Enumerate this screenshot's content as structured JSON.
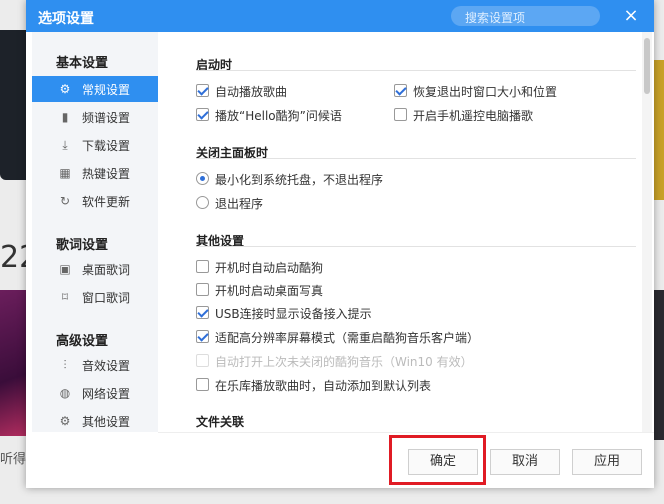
{
  "background": {
    "number": "22",
    "caption": "听得"
  },
  "dialog": {
    "title": "选项设置",
    "search_placeholder": "搜索设置项",
    "close_icon": "close-icon"
  },
  "sidebar": {
    "groups": [
      {
        "label": "基本设置",
        "items": [
          {
            "label": "常规设置",
            "icon": "gear-icon",
            "active": true
          },
          {
            "label": "频谱设置",
            "icon": "spectrum-icon"
          },
          {
            "label": "下载设置",
            "icon": "download-icon"
          },
          {
            "label": "热键设置",
            "icon": "keyboard-icon"
          },
          {
            "label": "软件更新",
            "icon": "refresh-icon"
          }
        ]
      },
      {
        "label": "歌词设置",
        "items": [
          {
            "label": "桌面歌词",
            "icon": "desktop-lyrics-icon"
          },
          {
            "label": "窗口歌词",
            "icon": "window-lyrics-icon"
          }
        ]
      },
      {
        "label": "高级设置",
        "items": [
          {
            "label": "音效设置",
            "icon": "equalizer-icon"
          },
          {
            "label": "网络设置",
            "icon": "globe-icon"
          },
          {
            "label": "其他设置",
            "icon": "settings-icon"
          }
        ]
      }
    ]
  },
  "content": {
    "startup": {
      "title": "启动时",
      "options": [
        {
          "label": "自动播放歌曲",
          "checked": true
        },
        {
          "label": "恢复退出时窗口大小和位置",
          "checked": true
        },
        {
          "label": "播放“Hello酷狗”问候语",
          "checked": true
        },
        {
          "label": "开启手机遥控电脑播歌",
          "checked": false
        }
      ]
    },
    "close_panel": {
      "title": "关闭主面板时",
      "options": [
        {
          "label": "最小化到系统托盘，不退出程序",
          "selected": true
        },
        {
          "label": "退出程序",
          "selected": false
        }
      ]
    },
    "other": {
      "title": "其他设置",
      "options": [
        {
          "label": "开机时自动启动酷狗",
          "checked": false
        },
        {
          "label": "开机时启动桌面写真",
          "checked": false
        },
        {
          "label": "USB连接时显示设备接入提示",
          "checked": true
        },
        {
          "label": "适配高分辨率屏幕模式（需重启酷狗音乐客户端）",
          "checked": true
        },
        {
          "label": "自动打开上次未关闭的酷狗音乐（Win10 有效）",
          "checked": false,
          "disabled": true
        },
        {
          "label": "在乐库播放歌曲时，自动添加到默认列表",
          "checked": false
        }
      ]
    },
    "file_assoc": {
      "title": "文件关联"
    }
  },
  "footer": {
    "ok": "确定",
    "cancel": "取消",
    "apply": "应用"
  }
}
